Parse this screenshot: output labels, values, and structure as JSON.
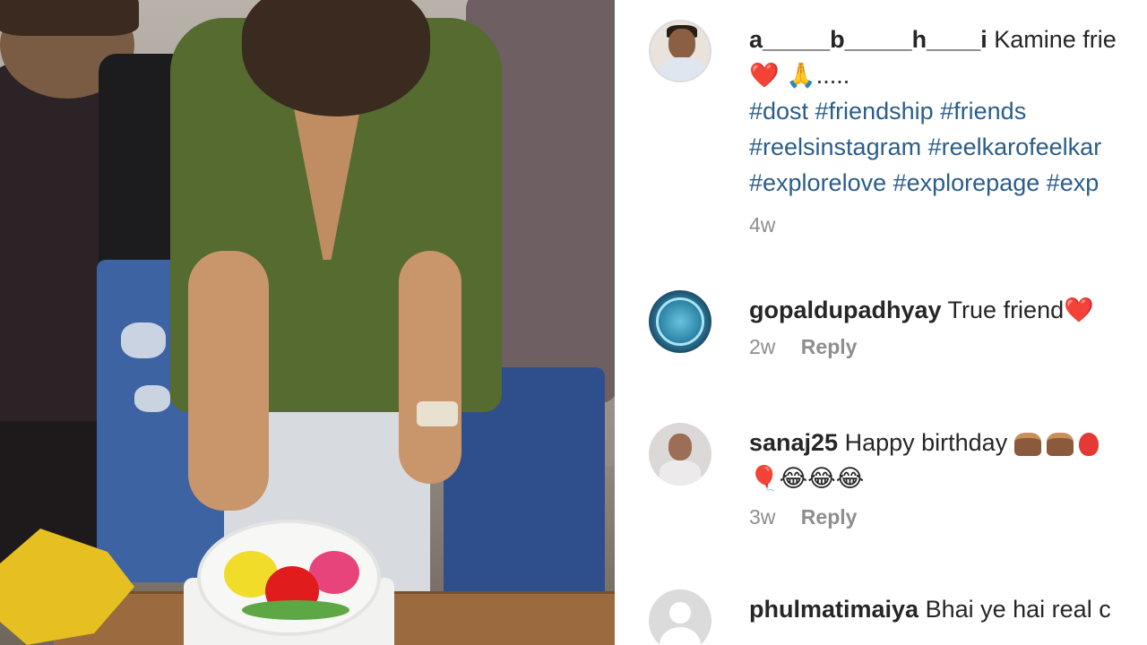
{
  "post": {
    "caption": {
      "username": "a_____b_____h____i",
      "text": "Kamine frie",
      "emoji_line": "❤️ 🙏.....",
      "hashtags_line1": "#dost #friendship #friends",
      "hashtags_line2": "#reelsinstagram #reelkarofeelkar",
      "hashtags_line3": "#explorelove #explorepage #exp",
      "time": "4w"
    }
  },
  "comments": [
    {
      "username": "gopaldupadhyay",
      "text": "True friend",
      "emoji": "❤️",
      "time": "2w",
      "reply_label": "Reply"
    },
    {
      "username": "sanaj25",
      "text": "Happy birthday",
      "emoji_line2": "🎈😂😂😂",
      "time": "3w",
      "reply_label": "Reply"
    },
    {
      "username": "phulmatimaiya",
      "text": "Bhai ye hai real c"
    }
  ],
  "colors": {
    "hashtag": "#2b5d8a",
    "meta": "#8e8e8e",
    "heart": "#e0242f"
  }
}
